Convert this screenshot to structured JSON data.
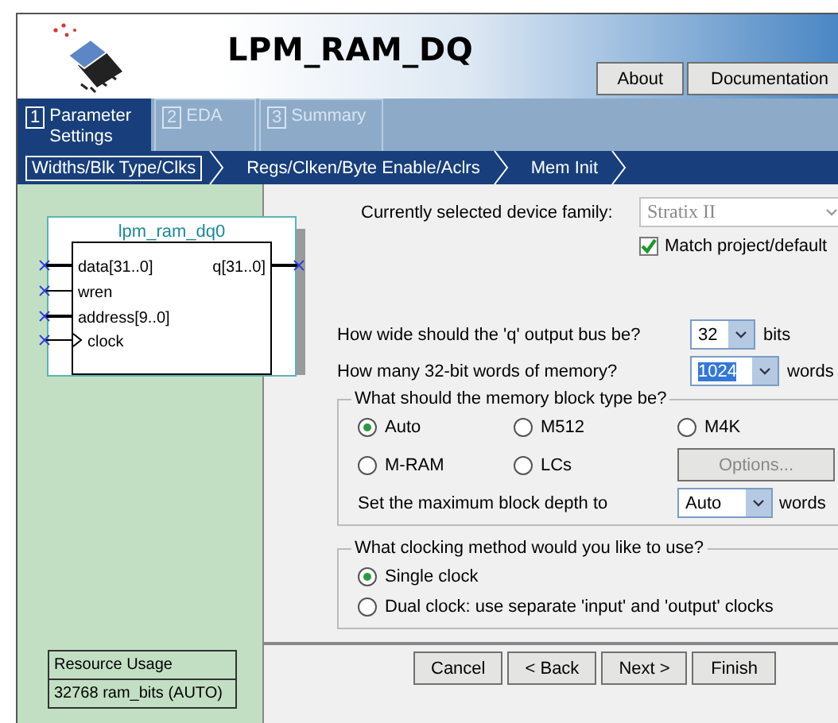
{
  "header": {
    "title": "LPM_RAM_DQ",
    "buttons": [
      "About",
      "Documentation"
    ]
  },
  "tabs": [
    {
      "number": "1",
      "label": "Parameter Settings",
      "selected": true
    },
    {
      "number": "2",
      "label": "EDA",
      "selected": false
    },
    {
      "number": "3",
      "label": "Summary",
      "selected": false
    }
  ],
  "steps": [
    {
      "label": "Widths/Blk Type/Clks",
      "selected": true
    },
    {
      "label": "Regs/Clken/Byte Enable/Aclrs",
      "selected": false
    },
    {
      "label": "Mem Init",
      "selected": false
    }
  ],
  "symbol": {
    "name": "lpm_ram_dq0",
    "inputs": [
      {
        "label": "data[31..0]",
        "kind": "bus"
      },
      {
        "label": "wren",
        "kind": "wire"
      },
      {
        "label": "address[9..0]",
        "kind": "bus"
      },
      {
        "label": "clock",
        "kind": "clock"
      }
    ],
    "outputs": [
      {
        "label": "q[31..0]",
        "kind": "bus"
      }
    ]
  },
  "resource_usage": {
    "title": "Resource Usage",
    "value": "32768 ram_bits (AUTO)"
  },
  "device_family": {
    "label": "Currently selected device family:",
    "value": "Stratix II",
    "disabled": true
  },
  "match_project": {
    "label": "Match project/default",
    "checked": true
  },
  "bus_width": {
    "label": "How wide should the 'q' output bus be?",
    "value": "32",
    "unit": "bits",
    "text_selected": false
  },
  "words": {
    "label": "How many 32-bit words of memory?",
    "value": "1024",
    "unit": "words",
    "text_selected": true
  },
  "memory_block": {
    "title": "What should the memory block type be?",
    "options": [
      {
        "label": "Auto",
        "selected": true
      },
      {
        "label": "M512",
        "selected": false
      },
      {
        "label": "M4K",
        "selected": false
      },
      {
        "label": "M-RAM",
        "selected": false
      },
      {
        "label": "LCs",
        "selected": false
      }
    ],
    "options_button": {
      "label": "Options...",
      "disabled": true
    },
    "depth": {
      "label": "Set the maximum block depth to",
      "value": "Auto",
      "unit": "words"
    }
  },
  "clocking": {
    "title": "What clocking method would you like to use?",
    "options": [
      {
        "label": "Single clock",
        "selected": true
      },
      {
        "label": "Dual clock: use separate 'input' and 'output' clocks",
        "selected": false
      }
    ]
  },
  "buttons": [
    "Cancel",
    "< Back",
    "Next >",
    "Finish"
  ]
}
